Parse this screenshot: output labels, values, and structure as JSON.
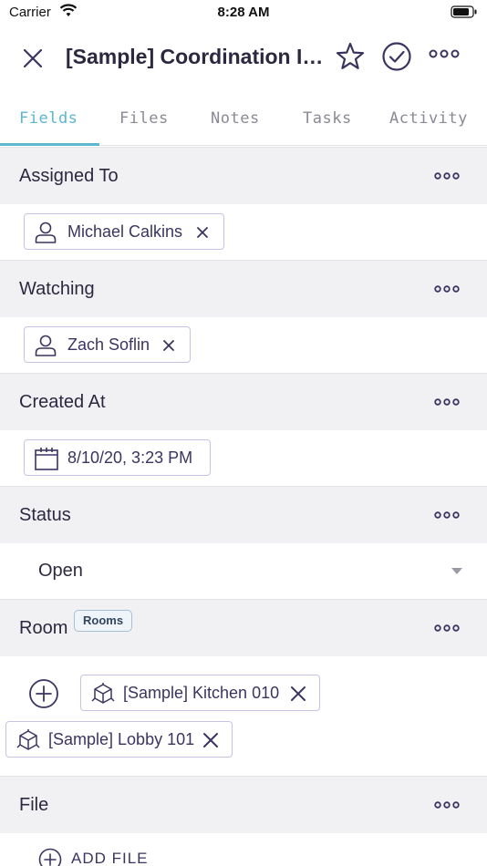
{
  "status_bar": {
    "carrier": "Carrier",
    "time": "8:28 AM"
  },
  "header": {
    "title": "[Sample] Coordination Iss..."
  },
  "tabs": [
    {
      "label": "Fields",
      "active": true
    },
    {
      "label": "Files"
    },
    {
      "label": "Notes"
    },
    {
      "label": "Tasks"
    },
    {
      "label": "Activity"
    }
  ],
  "fields": {
    "assigned_to": {
      "label": "Assigned To",
      "value": "Michael Calkins"
    },
    "watching": {
      "label": "Watching",
      "value": "Zach Soflin"
    },
    "created_at": {
      "label": "Created At",
      "value": "8/10/20, 3:23 PM"
    },
    "status": {
      "label": "Status",
      "value": "Open"
    },
    "room": {
      "label": "Room",
      "badge": "Rooms",
      "items": [
        "[Sample] Kitchen 010",
        "[Sample] Lobby 101"
      ]
    },
    "file": {
      "label": "File",
      "add_label": "ADD FILE"
    }
  },
  "colors": {
    "accent": "#5bb6cf",
    "chip_border": "#c8c2e6",
    "text": "#2b2840",
    "header_bg": "#f1f1f3"
  }
}
